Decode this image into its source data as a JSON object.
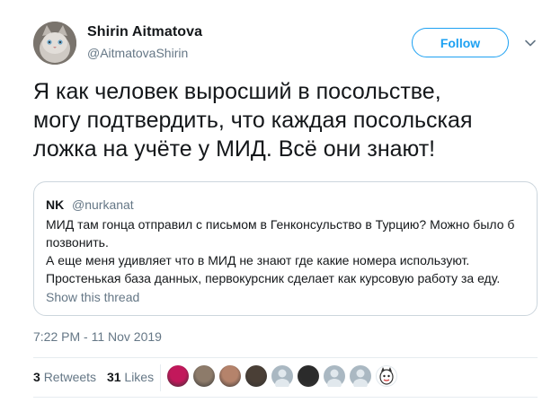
{
  "author": {
    "name": "Shirin Aitmatova",
    "handle": "@AitmatovaShirin",
    "avatar_icon": "cat-avatar"
  },
  "follow_label": "Follow",
  "tweet_lines": [
    "Я как человек выросший в посольстве,",
    "могу подтвердить, что каждая посольская",
    "ложка на учёте у МИД. Всё они знают!"
  ],
  "quote": {
    "name": "NK",
    "handle": "@nurkanat",
    "lines": [
      "МИД там гонца отправил с письмом в Генконсульство в Турцию? Можно было б",
      "позвонить.",
      "А еще меня удивляет что в МИД не знают где какие номера используют.",
      "Простенькая база данных, первокурсник сделает как курсовую работу за еду."
    ],
    "show_thread": "Show this thread"
  },
  "timestamp": "7:22 PM - 11 Nov 2019",
  "stats": {
    "retweets_count": "3",
    "retweets_label": "Retweets",
    "likes_count": "31",
    "likes_label": "Likes"
  },
  "likers": [
    {
      "name": "liker-1",
      "color": "#c2185b"
    },
    {
      "name": "liker-2",
      "color": "#8d7b6a"
    },
    {
      "name": "liker-3",
      "color": "#b5836b"
    },
    {
      "name": "liker-4",
      "color": "#4a3f36"
    },
    {
      "name": "liker-5",
      "color": "#aab8c2"
    },
    {
      "name": "liker-6",
      "color": "#2b2b2b"
    },
    {
      "name": "liker-7",
      "color": "#aab8c2"
    },
    {
      "name": "liker-8",
      "color": "#aab8c2"
    },
    {
      "name": "liker-9",
      "color": "#ffffff"
    }
  ],
  "colors": {
    "accent": "#1da1f2",
    "secondary_text": "#657786",
    "border": "#ccd6dd"
  }
}
